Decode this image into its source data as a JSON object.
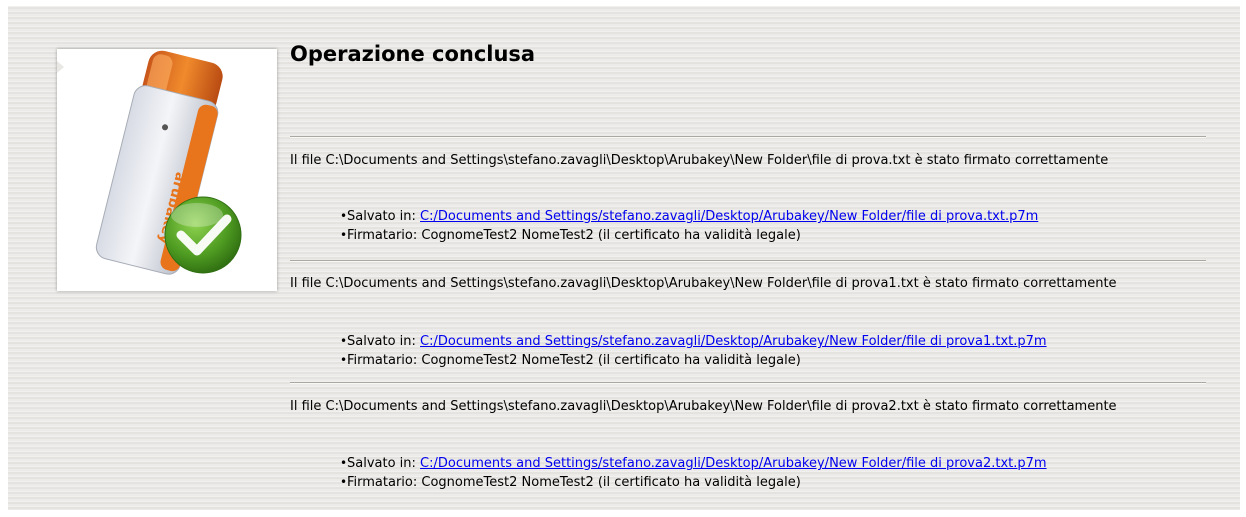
{
  "title": "Operazione conclusa",
  "colors": {
    "link": "#0000ee",
    "accent_orange": "#e8741c",
    "check_green": "#55a426"
  },
  "image": {
    "icon": "usb-key-checkmark-icon",
    "brand_text": "arubakey"
  },
  "results": [
    {
      "message": "Il file C:\\Documents and Settings\\stefano.zavagli\\Desktop\\Arubakey\\New Folder\\file di prova.txt è stato firmato correttamente",
      "saved_label": "Salvato in: ",
      "saved_path": "C:/Documents and Settings/stefano.zavagli/Desktop/Arubakey/New Folder/file di prova.txt.p7m",
      "signer": "Firmatario: CognomeTest2 NomeTest2 (il certificato ha validità legale)"
    },
    {
      "message": "Il file C:\\Documents and Settings\\stefano.zavagli\\Desktop\\Arubakey\\New Folder\\file di prova1.txt è stato firmato correttamente",
      "saved_label": "Salvato in: ",
      "saved_path": "C:/Documents and Settings/stefano.zavagli/Desktop/Arubakey/New Folder/file di prova1.txt.p7m",
      "signer": "Firmatario: CognomeTest2 NomeTest2 (il certificato ha validità legale)"
    },
    {
      "message": "Il file C:\\Documents and Settings\\stefano.zavagli\\Desktop\\Arubakey\\New Folder\\file di prova2.txt è stato firmato correttamente",
      "saved_label": "Salvato in: ",
      "saved_path": "C:/Documents and Settings/stefano.zavagli/Desktop/Arubakey/New Folder/file di prova2.txt.p7m",
      "signer": "Firmatario: CognomeTest2 NomeTest2 (il certificato ha validità legale)"
    }
  ]
}
